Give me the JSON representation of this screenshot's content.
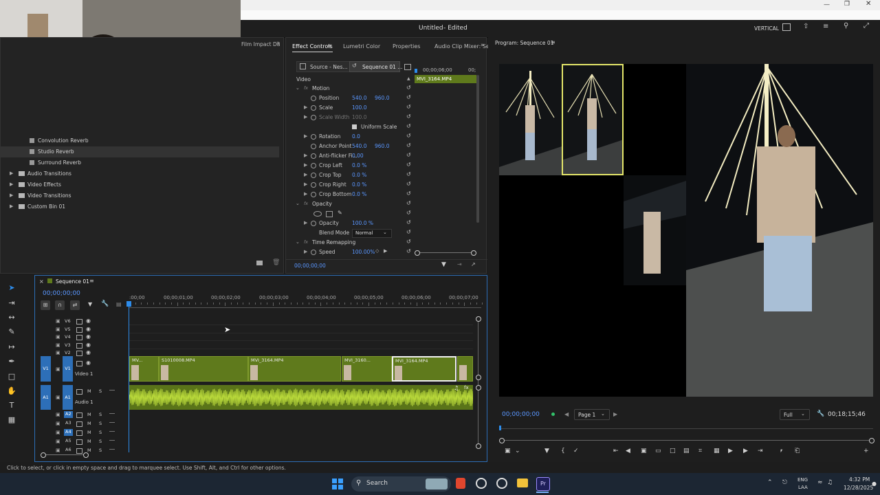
{
  "window": {
    "title": "Untitled",
    "status": "- Edited",
    "layout": "VERTICAL"
  },
  "effects_panel": {
    "top_tab": "Film Impact Da",
    "items": [
      {
        "label": "Convolution Reverb",
        "type": "effect"
      },
      {
        "label": "Studio Reverb",
        "type": "effect",
        "selected": true
      },
      {
        "label": "Surround Reverb",
        "type": "effect"
      },
      {
        "label": "Audio Transitions",
        "type": "folder"
      },
      {
        "label": "Video Effects",
        "type": "folder"
      },
      {
        "label": "Video Transitions",
        "type": "folder"
      },
      {
        "label": "Custom Bin 01",
        "type": "folder"
      }
    ]
  },
  "effect_controls": {
    "tabs": [
      "Effect Controls",
      "Lumetri Color",
      "Properties",
      "Audio Clip Mixer: Se"
    ],
    "source_label": "Source - Nes...",
    "sequence_label": "Sequence 01 ...",
    "ruler_time": "00;00;06;00",
    "ruler_time2": "00;",
    "clip_name": "MVI_3164.MP4",
    "section": "Video",
    "rows": [
      {
        "indent": 0,
        "fx": true,
        "label": "Motion",
        "open": true
      },
      {
        "indent": 1,
        "label": "Position",
        "v1": "540.0",
        "v2": "960.0"
      },
      {
        "indent": 1,
        "label": "Scale",
        "v1": "100.0",
        "expand": true
      },
      {
        "indent": 1,
        "label": "Scale Width",
        "v1": "100.0",
        "dim": true,
        "expand": true
      },
      {
        "indent": 1,
        "label": "Uniform Scale",
        "checkbox": true
      },
      {
        "indent": 1,
        "label": "Rotation",
        "v1": "0.0",
        "expand": true
      },
      {
        "indent": 1,
        "label": "Anchor Point",
        "v1": "540.0",
        "v2": "960.0"
      },
      {
        "indent": 1,
        "label": "Anti-flicker Fi...",
        "v1": "0.00",
        "expand": true
      },
      {
        "indent": 1,
        "label": "Crop Left",
        "v1": "0.0 %",
        "expand": true
      },
      {
        "indent": 1,
        "label": "Crop Top",
        "v1": "0.0 %",
        "expand": true
      },
      {
        "indent": 1,
        "label": "Crop Right",
        "v1": "0.0 %",
        "expand": true
      },
      {
        "indent": 1,
        "label": "Crop Bottom",
        "v1": "0.0 %",
        "expand": true
      },
      {
        "indent": 0,
        "fx": true,
        "label": "Opacity",
        "open": true
      },
      {
        "indent": 1,
        "label": "",
        "masks": true
      },
      {
        "indent": 1,
        "label": "Opacity",
        "v1": "100.0 %",
        "expand": true
      },
      {
        "indent": 1,
        "label": "Blend Mode",
        "dropdown": "Normal"
      },
      {
        "indent": 0,
        "fx": true,
        "label": "Time Remapping",
        "open": true
      },
      {
        "indent": 1,
        "label": "Speed",
        "v1": "100.00%",
        "expand": true
      }
    ],
    "current_time": "00;00;00;00"
  },
  "program_monitor": {
    "title": "Program: Sequence 01",
    "timecode": "00;00;00;00",
    "page": "Page 1",
    "zoom": "Full",
    "duration": "00;18;15;46"
  },
  "timeline": {
    "title": "Sequence 01",
    "timecode": "00;00;00;00",
    "ruler": [
      ":00;00",
      "00;00;01;00",
      "00;00;02;00",
      "00;00;03;00",
      "00;00;04;00",
      "00;00;05;00",
      "00;00;06;00",
      "00;00;07;00"
    ],
    "video_tracks": [
      "V6",
      "V5",
      "V4",
      "V3",
      "V2"
    ],
    "v1_label": "Video 1",
    "a1_label": "Audio 1",
    "source_v": "V1",
    "source_a": "A1",
    "audio_tracks": [
      "A2",
      "A3",
      "A4",
      "A5",
      "A6"
    ],
    "clips": [
      {
        "name": "MV...",
        "selected": false
      },
      {
        "name": "S1010008.MP4",
        "selected": false
      },
      {
        "name": "MVI_3164.MP4",
        "selected": false
      },
      {
        "name": "MVI_3160...",
        "selected": false
      },
      {
        "name": "MVI_3164.MP4",
        "selected": true
      }
    ]
  },
  "status_bar": {
    "text": "Click to select, or click in empty space and drag to marquee select. Use Shift, Alt, and Ctrl for other options."
  },
  "taskbar": {
    "search": "Search",
    "lang_top": "ENG",
    "lang_bottom": "LAA",
    "time": "4:32 PM",
    "date": "12/28/2025"
  },
  "colors": {
    "accent": "#2d8ceb",
    "clip": "#5f7a1c",
    "audio": "#a8c82c",
    "value_blue": "#5a97ff"
  }
}
